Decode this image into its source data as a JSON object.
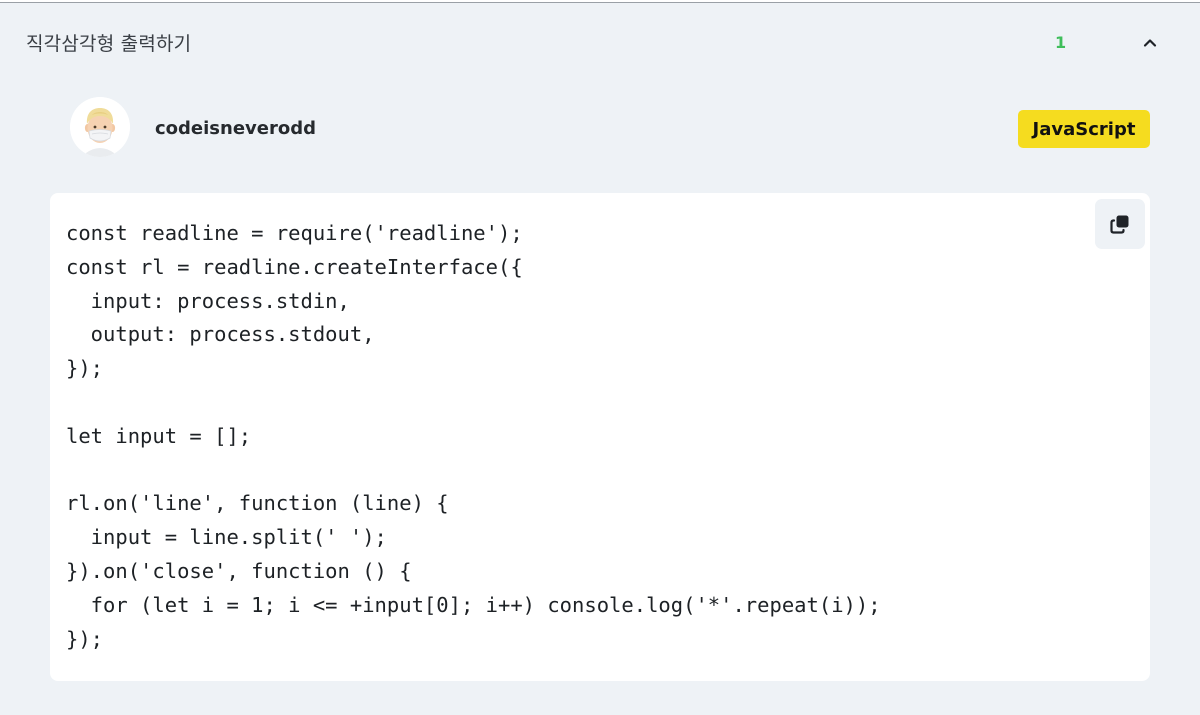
{
  "header": {
    "title": "직각삼각형 출력하기",
    "count": "1",
    "toggle_icon": "chevron-up-icon"
  },
  "author": {
    "username": "codeisneverodd",
    "avatar_icon": "memoji-avatar",
    "language": "JavaScript"
  },
  "code": {
    "copy_icon": "copy-icon",
    "lines": [
      "const readline = require('readline');",
      "const rl = readline.createInterface({",
      "  input: process.stdin,",
      "  output: process.stdout,",
      "});",
      "",
      "let input = [];",
      "",
      "rl.on('line', function (line) {",
      "  input = line.split(' ');",
      "}).on('close', function () {",
      "  for (let i = 1; i <= +input[0]; i++) console.log('*'.repeat(i));",
      "});"
    ]
  },
  "colors": {
    "panel_bg": "#eef2f6",
    "count_green": "#3fbe5b",
    "badge_yellow": "#f5dc1f",
    "card_bg": "#ffffff"
  }
}
